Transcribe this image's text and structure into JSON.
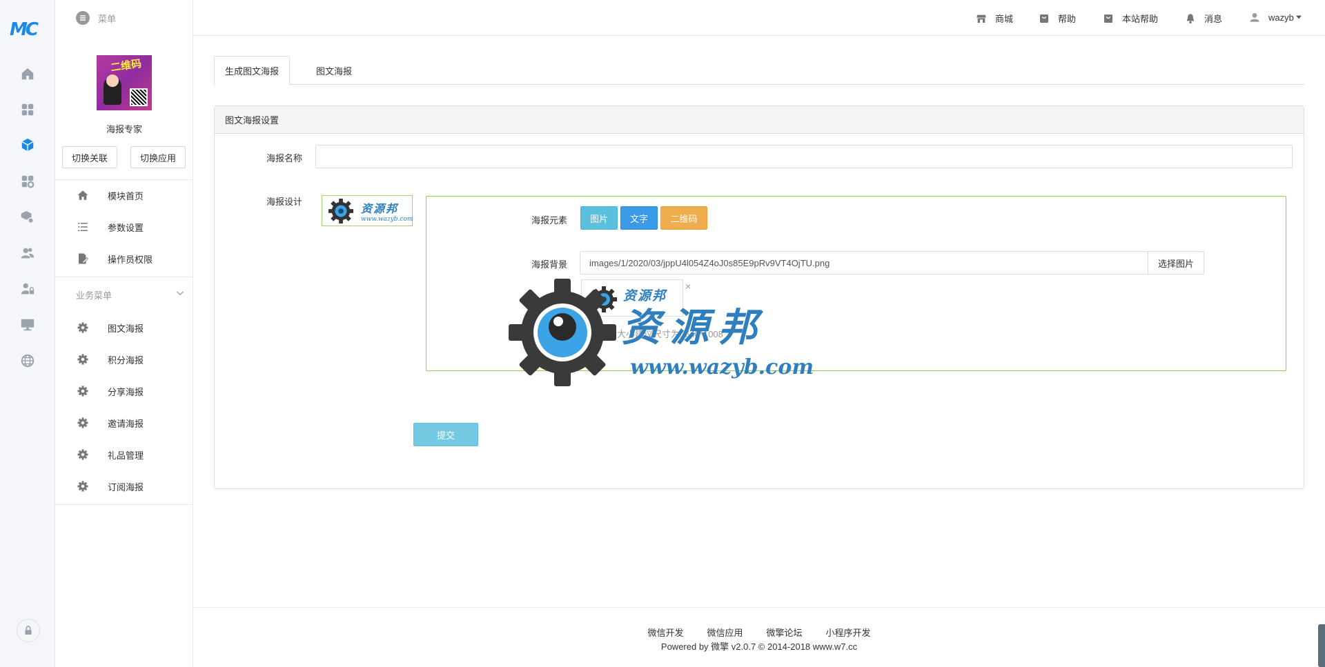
{
  "brand": {
    "logo_text": "MC",
    "accent": "#1e88e5"
  },
  "rail": {
    "items": [
      "home-icon",
      "apps-icon",
      "module-icon",
      "app-store-icon",
      "box-settings-icon",
      "users-icon",
      "user-lock-icon",
      "monitor-icon",
      "globe-icon"
    ],
    "active_index": 2,
    "bottom": "lock-icon"
  },
  "header": {
    "menu_label": "菜单",
    "links": [
      {
        "icon": "store-icon",
        "label": "商城"
      },
      {
        "icon": "help-bag-icon",
        "label": "帮助"
      },
      {
        "icon": "site-help-icon",
        "label": "本站帮助"
      },
      {
        "icon": "bell-icon",
        "label": "消息"
      }
    ],
    "user": "wazyb"
  },
  "sidebar": {
    "app_name": "海报专家",
    "app_thumb_text": "二维码",
    "switch_related": "切换关联",
    "switch_app": "切换应用",
    "top_items": [
      {
        "icon": "home-icon",
        "label": "模块首页"
      },
      {
        "icon": "list-icon",
        "label": "参数设置"
      },
      {
        "icon": "doc-edit-icon",
        "label": "操作员权限"
      }
    ],
    "group_title": "业务菜单",
    "group_items": [
      {
        "icon": "gear-icon",
        "label": "图文海报"
      },
      {
        "icon": "gear-icon",
        "label": "积分海报"
      },
      {
        "icon": "gear-icon",
        "label": "分享海报"
      },
      {
        "icon": "gear-icon",
        "label": "邀请海报"
      },
      {
        "icon": "gear-icon",
        "label": "礼品管理"
      },
      {
        "icon": "gear-icon",
        "label": "订阅海报"
      }
    ]
  },
  "main": {
    "tabs": [
      {
        "label": "生成图文海报",
        "active": true
      },
      {
        "label": "图文海报",
        "active": false
      }
    ],
    "panel_title": "图文海报设置",
    "poster_name_label": "海报名称",
    "poster_name_value": "",
    "poster_design_label": "海报设计",
    "elements_label": "海报元素",
    "element_buttons": [
      {
        "label": "图片",
        "color": "#5bc0de"
      },
      {
        "label": "文字",
        "color": "#3a9ae8"
      },
      {
        "label": "二维码",
        "color": "#f0ad4e"
      }
    ],
    "background_label": "海报背景",
    "background_value": "images/1/2020/03/jppU4l054Z4oJ0s85E9pRv9VT4OjTU.png",
    "pick_image": "选择图片",
    "thumb_close": "×",
    "help_text": "海报背景大小建议尺寸为: 640*1008",
    "submit": "提交"
  },
  "watermark": {
    "text": "资源邦",
    "url": "www.wazyb.com",
    "mini_text": "资源邦",
    "mini_url": "www.wazyb.com"
  },
  "footer": {
    "links": [
      "微信开发",
      "微信应用",
      "微擎论坛",
      "小程序开发"
    ],
    "powered": "Powered by 微擎 v2.0.7 © 2014-2018 www.w7.cc"
  }
}
